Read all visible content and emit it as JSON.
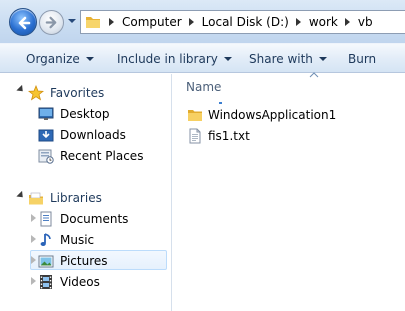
{
  "address_bar": {
    "crumbs": [
      "Computer",
      "Local Disk (D:)",
      "work",
      "vb"
    ]
  },
  "command_bar": {
    "organize": "Organize",
    "include_in_library": "Include in library",
    "share_with": "Share with",
    "burn": "Burn"
  },
  "nav_pane": {
    "favorites": {
      "label": "Favorites",
      "items": [
        "Desktop",
        "Downloads",
        "Recent Places"
      ]
    },
    "libraries": {
      "label": "Libraries",
      "items": [
        "Documents",
        "Music",
        "Pictures",
        "Videos"
      ],
      "selected": "Pictures"
    }
  },
  "content": {
    "column_name": "Name",
    "files": [
      {
        "name": "WindowsApplication1",
        "icon": "folder-icon"
      },
      {
        "name": "fis1.txt",
        "icon": "text-file-icon"
      }
    ]
  },
  "colors": {
    "accent": "#1e395b",
    "selection": "#e6f1fd",
    "folder": "#f4c94a"
  }
}
